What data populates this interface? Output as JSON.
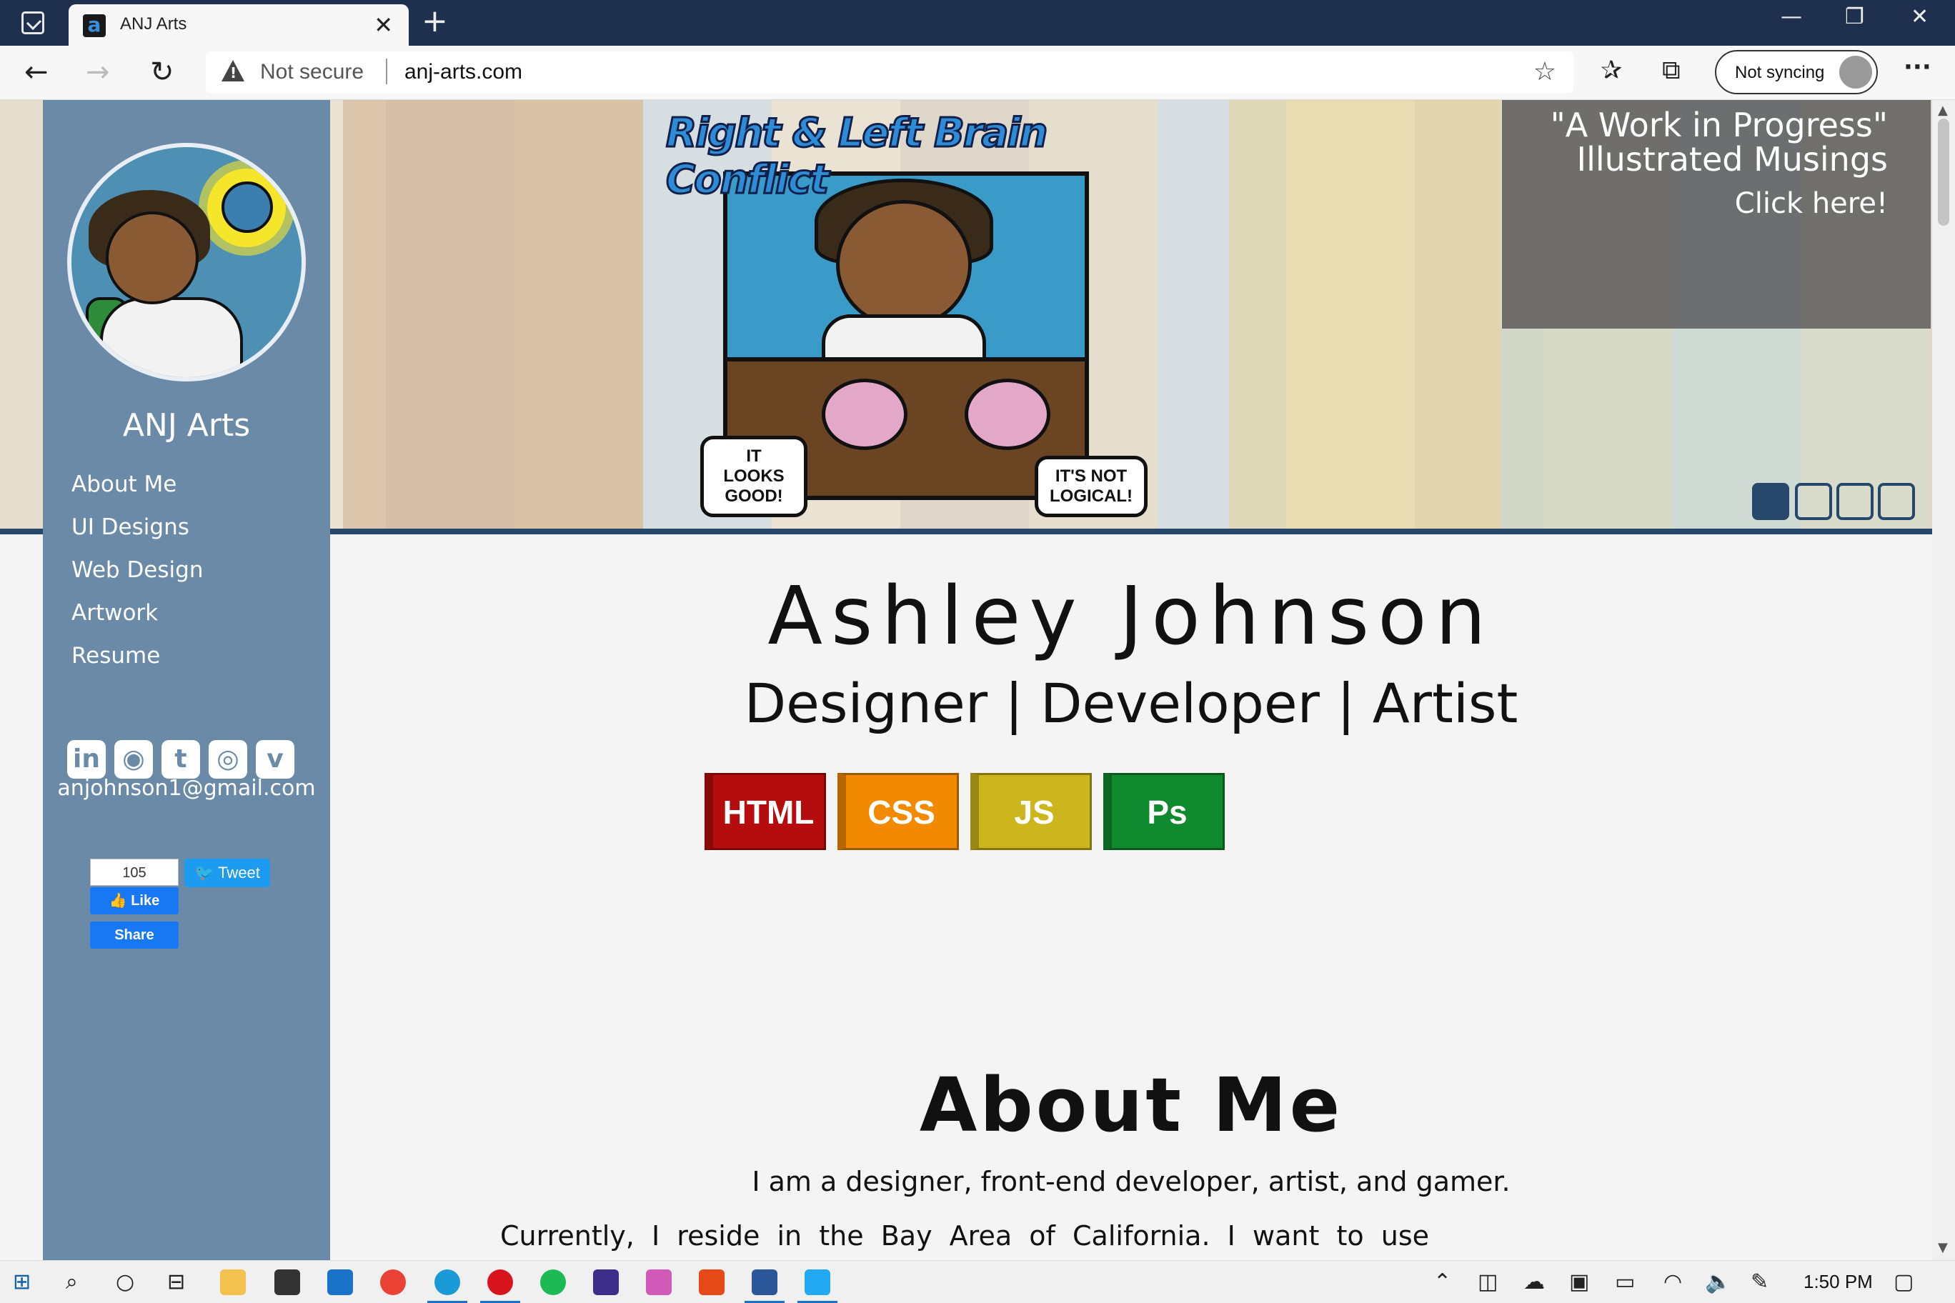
{
  "browser": {
    "tab_title": "ANJ Arts",
    "address_warning": "Not secure",
    "url": "anj-arts.com",
    "sync_label": "Not syncing"
  },
  "sidebar": {
    "brand": "ANJ Arts",
    "nav": [
      {
        "label": "About Me"
      },
      {
        "label": "UI Designs"
      },
      {
        "label": "Web Design"
      },
      {
        "label": "Artwork"
      },
      {
        "label": "Resume"
      }
    ],
    "social_icons": [
      "linkedin-icon",
      "github-icon",
      "tumblr-icon",
      "instagram-icon",
      "vimeo-icon"
    ],
    "email": "anjohnson1@gmail.com",
    "fb_like_count": "105",
    "fb_like_label": "Like",
    "fb_share_label": "Share",
    "tweet_label": "Tweet"
  },
  "banner": {
    "comic_title": "Right & Left Brain Conflict",
    "bubble_left": "IT LOOKS GOOD!",
    "bubble_right": "IT'S NOT LOGICAL!",
    "promo_line1": "\"A Work in Progress\"",
    "promo_line2": "Illustrated Musings",
    "promo_cta": "Click here!",
    "slides_total": 4,
    "active_slide": 1
  },
  "main": {
    "name": "Ashley Johnson",
    "tagline": "Designer | Developer | Artist",
    "skills": [
      {
        "label": "HTML",
        "color": "#b50d0d"
      },
      {
        "label": "CSS",
        "color": "#f28a00"
      },
      {
        "label": "JS",
        "color": "#cdb51e"
      },
      {
        "label": "Ps",
        "color": "#0f8a2f"
      }
    ],
    "about_heading": "About Me",
    "about_lead": "I am a designer, front-end developer, artist, and gamer.",
    "about_text": "Currently, I reside in the Bay Area of California. I want to use my"
  },
  "taskbar": {
    "clock": "1:50 PM"
  }
}
